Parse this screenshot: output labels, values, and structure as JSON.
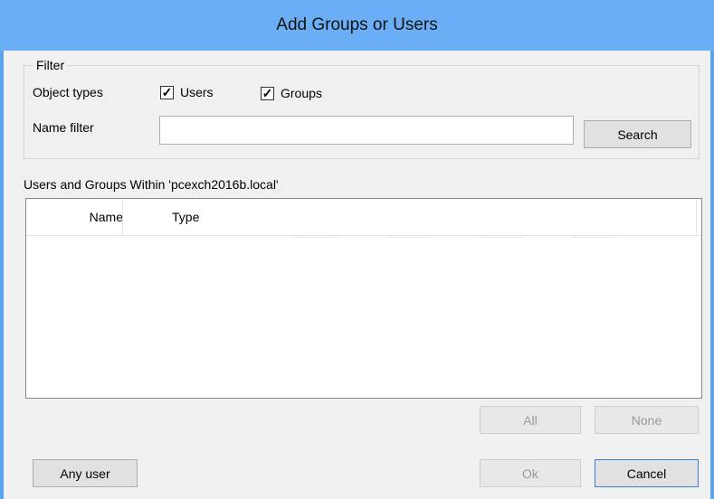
{
  "window": {
    "title": "Add Groups or Users"
  },
  "filter": {
    "legend": "Filter",
    "object_types_label": "Object types",
    "users": {
      "label": "Users",
      "checked": true
    },
    "groups": {
      "label": "Groups",
      "checked": true
    },
    "name_filter_label": "Name filter",
    "name_filter_value": "",
    "search_label": "Search"
  },
  "results": {
    "heading": "Users and Groups Within 'pcexch2016b.local'",
    "columns": [
      "Name",
      "Type"
    ],
    "rows": []
  },
  "selection": {
    "all_label": "All",
    "none_label": "None"
  },
  "footer": {
    "any_user_label": "Any user",
    "ok_label": "Ok",
    "cancel_label": "Cancel"
  },
  "colors": {
    "titlebar": "#6aaef5",
    "border": "#5ba4ee",
    "background": "#f0f0f0"
  }
}
